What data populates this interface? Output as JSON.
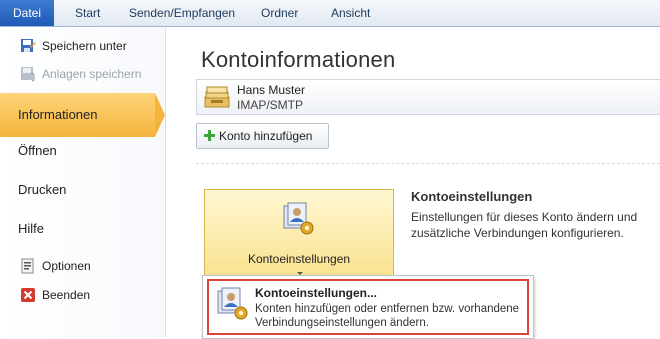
{
  "ribbon": {
    "tabs": [
      "Datei",
      "Start",
      "Senden/Empfangen",
      "Ordner",
      "Ansicht"
    ]
  },
  "sidebar": {
    "save_as": "Speichern unter",
    "save_attachments": "Anlagen speichern",
    "info": "Informationen",
    "open": "Öffnen",
    "print": "Drucken",
    "help": "Hilfe",
    "options": "Optionen",
    "exit": "Beenden"
  },
  "main": {
    "title": "Kontoinformationen",
    "account": {
      "name": "Hans Muster",
      "type": "IMAP/SMTP"
    },
    "add_account_label": "Konto hinzufügen",
    "account_settings_button": "Kontoeinstellungen",
    "section": {
      "title": "Kontoeinstellungen",
      "description": "Einstellungen für dieses Konto ändern und zusätzliche Verbindungen konfigurieren."
    },
    "obscured_heading_tail": "n"
  },
  "dropdown": {
    "item_title": "Kontoeinstellungen...",
    "item_description": "Konten hinzufügen oder entfernen bzw. vorhandene Verbindungseinstellungen ändern."
  },
  "colors": {
    "file_tab": "#2a66c4",
    "active_nav": "#f4b43c",
    "highlight_border": "#d9433a"
  }
}
